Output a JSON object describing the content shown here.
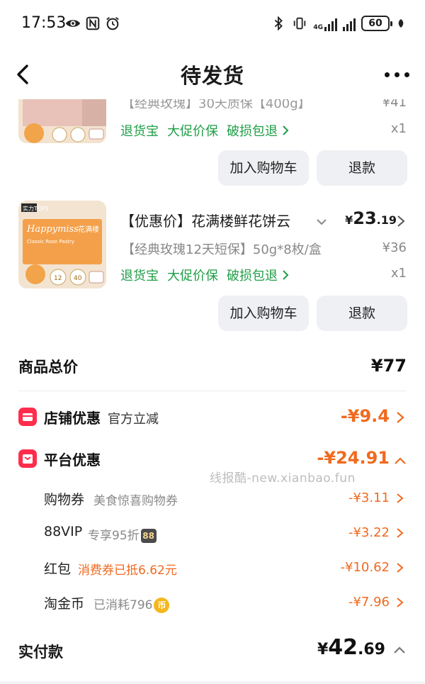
{
  "status_bar": {
    "time": "17:53",
    "left_icons": [
      "eye-icon",
      "nfc-icon",
      "alarm-icon"
    ],
    "right_icons": [
      "bluetooth-icon",
      "vibrate-icon",
      "signal-4g-icon",
      "signal-icon"
    ],
    "network": "4G",
    "battery": "60"
  },
  "nav": {
    "title": "待发货",
    "back_icon": "chevron-left-icon",
    "more_icon": "more-icon"
  },
  "products": [
    {
      "name": "【经典玫瑰】30天质保【400g】",
      "price_orig": "¥41",
      "tags": [
        "退货宝",
        "大促价保",
        "破损包退"
      ],
      "qty": "x1",
      "buttons": [
        "加入购物车",
        "退款"
      ]
    },
    {
      "name": "【优惠价】花满楼鲜花饼云",
      "price_symbol": "¥",
      "price_int": "23",
      "price_dec": ".19",
      "spec": "【经典玫瑰12天短保】50g*8枚/盒",
      "price_orig": "¥36",
      "tags": [
        "退货宝",
        "大促价保",
        "破损包退"
      ],
      "qty": "x1",
      "buttons": [
        "加入购物车",
        "退款"
      ],
      "thumb": {
        "badge": "实力TOP1",
        "brand": "Happymiss",
        "brand_cn": "花满楼",
        "sub": "Classic Rose Pastry",
        "stat1": "12",
        "stat2": "40"
      }
    }
  ],
  "summary": {
    "total_label": "商品总价",
    "total_value": "¥77",
    "store_discount": {
      "title": "店铺优惠",
      "sub": "官方立减",
      "amount": "-¥9.4"
    },
    "platform_discount": {
      "title": "平台优惠",
      "amount": "-¥24.91"
    },
    "sub_items": [
      {
        "title": "购物券",
        "desc": "美食惊喜购物券",
        "amount": "-¥3.11"
      },
      {
        "title": "88VIP",
        "desc": "专享95折",
        "badge": "88",
        "amount": "-¥3.22"
      },
      {
        "title": "红包",
        "desc": "消费券已抵6.62元",
        "amount": "-¥10.62"
      },
      {
        "title": "淘金币",
        "desc": "已消耗796",
        "badge": "币",
        "amount": "-¥7.96"
      }
    ],
    "paid_label": "实付款",
    "paid_symbol": "¥",
    "paid_int": "42",
    "paid_dec": ".69"
  },
  "watermark": "线报酷-new.xianbao.fun",
  "colors": {
    "accent_orange": "#f06a1f",
    "tag_green": "#1f9e46",
    "discount_red": "#ff2d4b"
  }
}
